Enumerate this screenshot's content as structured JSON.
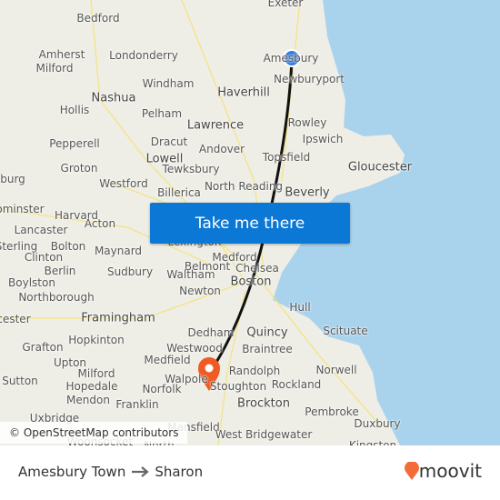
{
  "map": {
    "labels": [
      "Exeter",
      "Bedford",
      "Amesbury",
      "Newburyport",
      "Amherst",
      "Milford",
      "Londonderry",
      "Nashua",
      "Windham",
      "Haverhill",
      "Hollis",
      "Pelham",
      "Lawrence",
      "Rowley",
      "Ipswich",
      "Pepperell",
      "Dracut",
      "Andover",
      "Lowell",
      "Tewksbury",
      "Groton",
      "Topsfield",
      "Gloucester",
      "burg",
      "Westford",
      "North Reading",
      "Billerica",
      "Beverly",
      "ominster",
      "Harvard",
      "Acton",
      "Lancaster",
      "Sterling",
      "Bolton",
      "Maynard",
      "Lexington",
      "Clinton",
      "Berlin",
      "Sudbury",
      "Medford",
      "Belmont",
      "Waltham",
      "Chelsea",
      "Boylston",
      "Boston",
      "Northborough",
      "Newton",
      "Hull",
      "cester",
      "Framingham",
      "Quincy",
      "Dedham",
      "Hopkinton",
      "Scituate",
      "Grafton",
      "Westwood",
      "Braintree",
      "Upton",
      "Medfield",
      "Norwell",
      "Milford",
      "Walpole",
      "Randolph",
      "Sutton",
      "Hopedale",
      "Norfolk",
      "Stoughton",
      "Rockland",
      "Mendon",
      "Franklin",
      "Brockton",
      "Pembroke",
      "Uxbridge",
      "Mansfield",
      "West Bridgewater",
      "Duxbury",
      "Woonsocket",
      "North",
      "Kingston"
    ],
    "attribution": "© OpenStreetMap contributors",
    "origin_marker_color": "#2f7de1",
    "destination_marker_color": "#f05a23",
    "water_color": "#a9d3ec"
  },
  "cta": {
    "label": "Take me there",
    "color": "#0a78d4"
  },
  "footer": {
    "origin": "Amesbury Town",
    "destination": "Sharon",
    "brand": "moovit",
    "brand_color": "#f26b38"
  }
}
